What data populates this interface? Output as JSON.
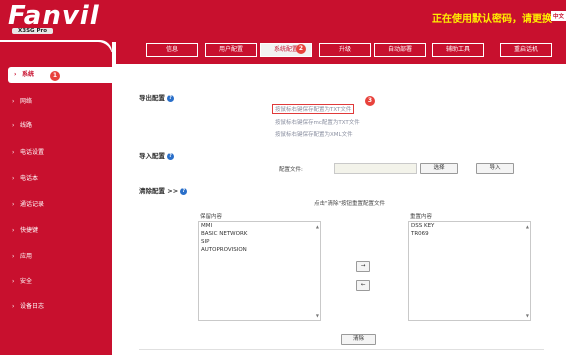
{
  "header": {
    "logo_text": "Fanvil",
    "model": "X3SG Pro",
    "warning": "正在使用默认密码，请更换",
    "lang": "中文"
  },
  "tabs": [
    {
      "label": "信息"
    },
    {
      "label": "用户配置"
    },
    {
      "label": "系统配置",
      "active": true
    },
    {
      "label": "升级"
    },
    {
      "label": "自动部署"
    },
    {
      "label": "辅助工具"
    },
    {
      "label": "重启话机"
    }
  ],
  "sidebar": {
    "items": [
      {
        "label": "系统",
        "active": true
      },
      {
        "label": "网络"
      },
      {
        "label": "线路"
      },
      {
        "label": "电话设置"
      },
      {
        "label": "电话本"
      },
      {
        "label": "通话记录"
      },
      {
        "label": "快捷键"
      },
      {
        "label": "应用"
      },
      {
        "label": "安全"
      },
      {
        "label": "设备日志"
      }
    ]
  },
  "export": {
    "title": "导出配置",
    "links": [
      "按鼠标右键保存配置为TXT文件",
      "按鼠标右键保存mc配置为TXT文件",
      "按鼠标右键保存配置为XML文件"
    ]
  },
  "import": {
    "title": "导入配置",
    "file_label": "配置文件:",
    "file_value": "",
    "select_button": "选择",
    "import_button": "导入"
  },
  "clear": {
    "title": "清除配置 >>",
    "hint": "点击\"清除\"按钮重置配置文件",
    "keep_header": "保留内容",
    "keep_items": [
      "MMI",
      "BASIC NETWORK",
      "SIP",
      "AUTOPROVISION"
    ],
    "reset_header": "重置内容",
    "reset_items": [
      "DSS KEY",
      "TR069"
    ],
    "move_right": "→",
    "move_left": "←",
    "clear_button": "清除"
  },
  "badges": {
    "one": "1",
    "two": "2",
    "three": "3"
  },
  "colors": {
    "brand_red": "#c8102e",
    "warning_yellow": "#ffee00",
    "link_gray": "#8a8fa0",
    "badge_red": "#e8423c"
  }
}
